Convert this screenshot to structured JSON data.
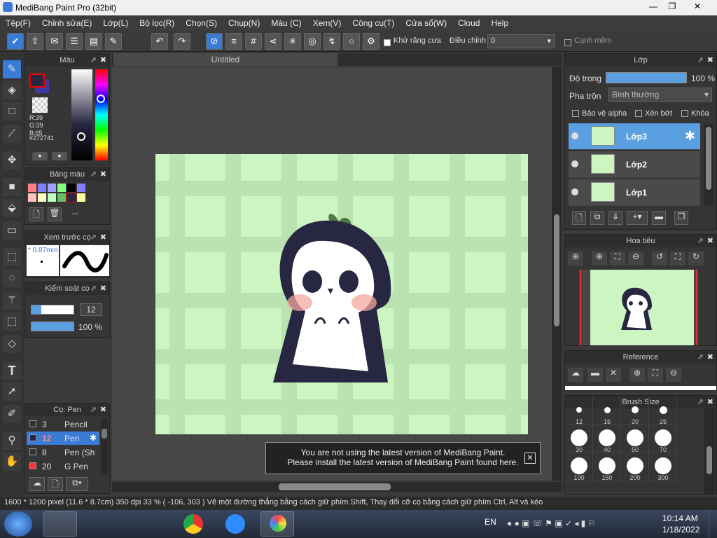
{
  "window": {
    "title": "MediBang Paint Pro (32bit)",
    "min": "—",
    "max": "❐",
    "close": "✕"
  },
  "menu": [
    "Tệp(F)",
    "Chỉnh sửa(E)",
    "Lớp(L)",
    "Bộ lọc(R)",
    "Chọn(S)",
    "Chụp(N)",
    "Màu (C)",
    "Xem(V)",
    "Công cụ(T)",
    "Cửa sổ(W)",
    "Cloud",
    "Help"
  ],
  "toolbar": {
    "antialias": "Khử răng cưa",
    "adjust_label": "Điều chỉnh",
    "adjust_value": "0",
    "soft_edge": "Cạnh mềm"
  },
  "color_panel": {
    "title": "Màu",
    "r": "R:39",
    "g": "G:39",
    "b": "B:65",
    "hex": "#272741",
    "fg": "#272741"
  },
  "palette": {
    "title": "Bảng màu",
    "name": "---",
    "colors": [
      "#ff8080",
      "#8080ff",
      "#a0a0ff",
      "#80ff80",
      "#000000",
      "#8080ff",
      "#ffc0c0",
      "#ffffc0",
      "#c0ffc0",
      "#60c060",
      "#272741",
      "#ffffa0"
    ]
  },
  "brush_preview": {
    "title": "Xem trước cọ",
    "size": "* 0.87mm"
  },
  "brush_control": {
    "title": "Kiểm soát cọ",
    "size": "12",
    "opacity": "100 %"
  },
  "brush_list": {
    "title": "Cọ: Pen",
    "items": [
      {
        "size": "3",
        "name": "Pencil",
        "color": "#333333"
      },
      {
        "size": "12",
        "name": "Pen",
        "color": "#272741"
      },
      {
        "size": "8",
        "name": "Pen (Sh",
        "color": "#333333"
      },
      {
        "size": "20",
        "name": "G Pen",
        "color": "#ff3333"
      }
    ]
  },
  "canvas": {
    "tab": "Untitled",
    "bg": "#ccf5c2"
  },
  "notice": {
    "line1": "You are not using the latest version of MediBang Paint.",
    "line2": "Please install the latest version of MediBang Paint found here.",
    "close": "✕"
  },
  "layers": {
    "title": "Lớp",
    "opacity_label": "Độ trong",
    "opacity_value": "100 %",
    "opacity": 1.0,
    "blend_label": "Pha trộn",
    "blend_value": "Bình thường",
    "protect_alpha": "Bảo vệ alpha",
    "clip": "Xén bớt",
    "lock": "Khóa",
    "items": [
      {
        "name": "Lớp3",
        "selected": true
      },
      {
        "name": "Lớp2",
        "selected": false
      },
      {
        "name": "Lớp1",
        "selected": false
      }
    ]
  },
  "navigator": {
    "title": "Hoa tiêu"
  },
  "reference": {
    "title": "Reference"
  },
  "brush_size": {
    "title": "Brush Size",
    "sizes": [
      "12",
      "15",
      "20",
      "25",
      "30",
      "40",
      "50",
      "70",
      "100",
      "150",
      "200",
      "300"
    ]
  },
  "status": {
    "text": "1600 * 1200 pixel  (11.6 * 8.7cm)  350 dpi  33 %  ( -106, 303 )  Vẽ một đường thẳng bằng cách giữ phím Shift, Thay đổi cỡ cọ bằng cách giữ phím Ctrl, Alt và kéo"
  },
  "taskbar": {
    "lang": "EN",
    "time": "10:14 AM",
    "date": "1/18/2022"
  }
}
